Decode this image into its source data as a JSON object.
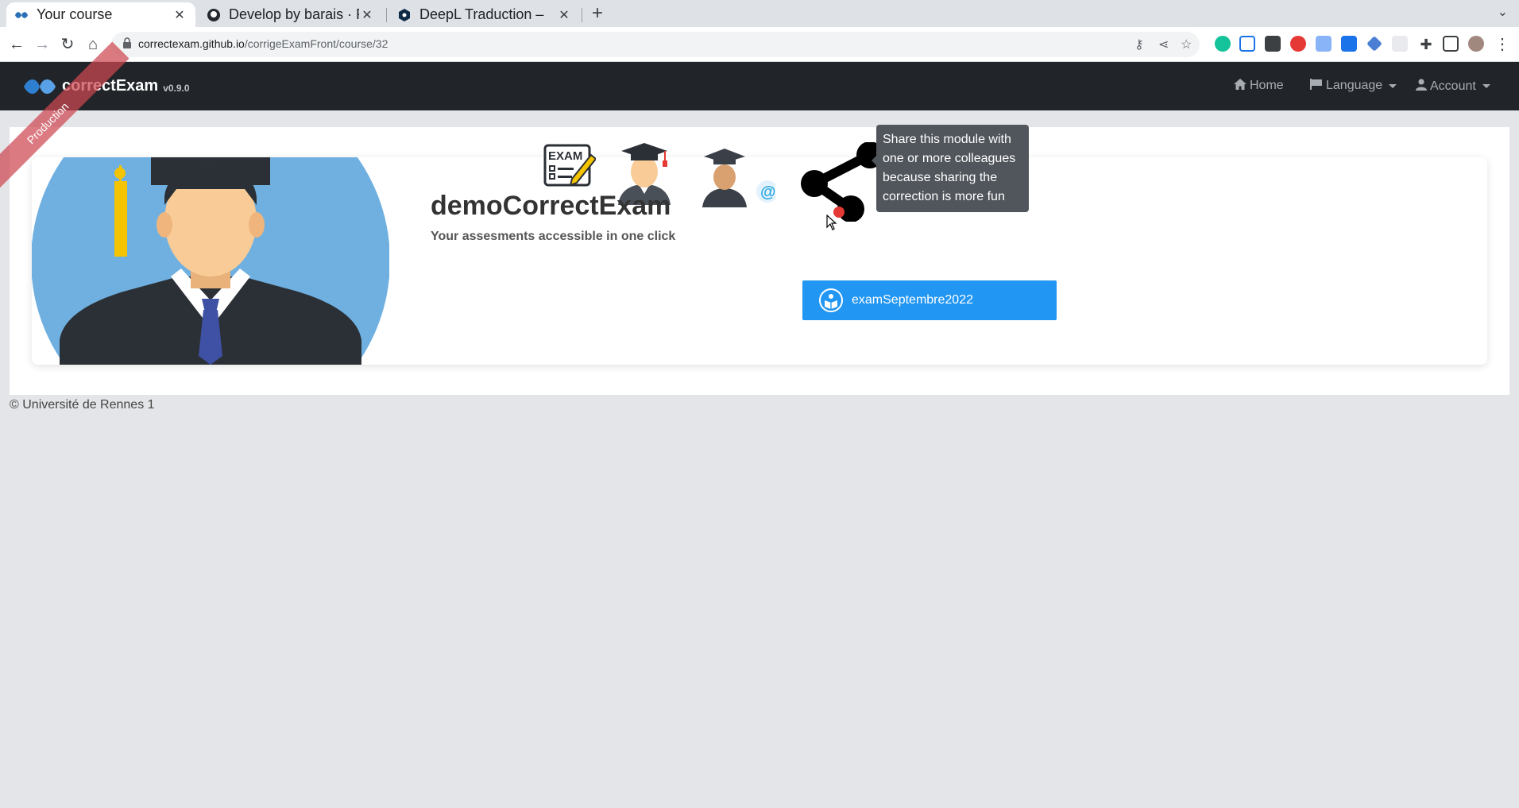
{
  "browser": {
    "tabs": [
      {
        "title": "Your course",
        "active": true
      },
      {
        "title": "Develop by barais · P",
        "active": false
      },
      {
        "title": "DeepL Traduction – ",
        "active": false
      }
    ],
    "url_host": "correctexam.github.io",
    "url_path": "/corrigeExamFront/course/32"
  },
  "navbar": {
    "brand_name": "correctExam",
    "brand_version": "v0.9.0",
    "home_label": "Home",
    "language_label": "Language",
    "account_label": "Account",
    "env_ribbon": "Production"
  },
  "course": {
    "title": "demoCorrectExam",
    "subtitle": "Your assesments accessible in one click",
    "exam_button_label": "examSeptembre2022",
    "share_tooltip": "Share this module with one or more colleagues because sharing the correction is more fun"
  },
  "footer": {
    "text": "© Université de Rennes 1"
  },
  "colors": {
    "navbar_bg": "#212529",
    "primary_button": "#2196f3",
    "avatar_circle": "#6fb0e0",
    "ribbon": "#cd4650"
  }
}
